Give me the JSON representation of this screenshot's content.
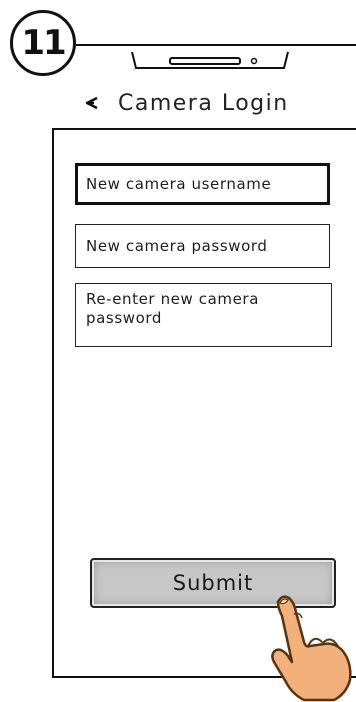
{
  "step": {
    "number": "11"
  },
  "nav": {
    "title": "Camera Login",
    "back_icon": "back-arrow-icon"
  },
  "form": {
    "username_placeholder": "New camera  username",
    "password_placeholder": "New camera  password",
    "reenter_placeholder": "Re-enter new  camera password"
  },
  "submit": {
    "label": "Submit"
  },
  "colors": {
    "button_bg": "#c7c7c7",
    "hand_skin": "#f2b07a",
    "outline": "#111111"
  },
  "icons": {
    "pointer": "pointing-hand-icon"
  }
}
